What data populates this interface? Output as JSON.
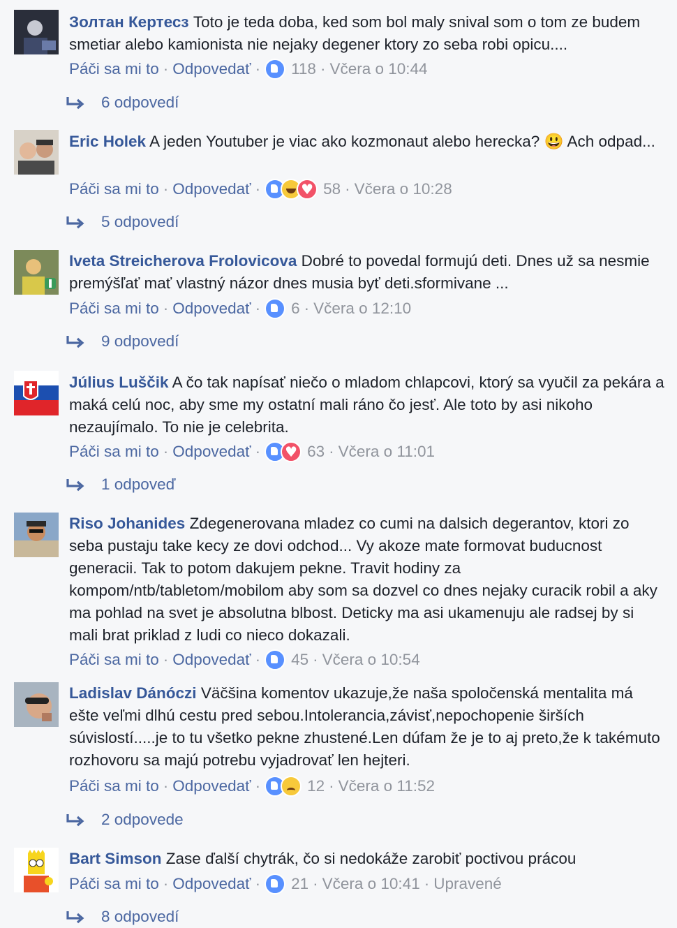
{
  "actions": {
    "like": "Páči sa mi to",
    "reply": "Odpovedať",
    "edited": "Upravené"
  },
  "colors": {
    "link": "#4b67a1",
    "author": "#365899",
    "meta": "#90949c",
    "like": "#5890ff",
    "love": "#f25268",
    "haha": "#f7c93b"
  },
  "comments": [
    {
      "author": "Золтан Кертесз",
      "text": "Toto je teda doba, ked som bol maly snival som o tom ze budem smetiar alebo kamionista nie nejaky degener ktory zo seba robi opicu....",
      "reactions": [
        "like-icon"
      ],
      "count": "118",
      "time": "Včera o 10:44",
      "replies": "6 odpovedí"
    },
    {
      "author": "Eric Holek",
      "text": "A jeden Youtuber je viac ako kozmonaut alebo herecka? 😃 Ach odpad...",
      "reactions": [
        "like-icon",
        "haha-icon",
        "love-icon"
      ],
      "count": "58",
      "time": "Včera o 10:28",
      "replies": "5 odpovedí"
    },
    {
      "author": "Iveta Streicherova Frolovicova",
      "text": "Dobré to povedal formujú deti. Dnes už sa nesmie premýšľať mať vlastný názor dnes musia byť deti.sformivane ...",
      "reactions": [
        "like-icon"
      ],
      "count": "6",
      "time": "Včera o 12:10",
      "replies": "9 odpovedí"
    },
    {
      "author": "Július Luščik",
      "text": "A čo tak napísať niečo o mladom chlapcovi, ktorý sa vyučil za pekára a maká celú noc, aby sme my ostatní mali ráno čo jesť. Ale toto by asi nikoho nezaujímalo. To nie je celebrita.",
      "reactions": [
        "like-icon",
        "love-icon"
      ],
      "count": "63",
      "time": "Včera o 11:01",
      "replies": "1 odpoveď"
    },
    {
      "author": "Riso Johanides",
      "text": "Zdegenerovana mladez co cumi na dalsich degerantov, ktori zo seba pustaju take kecy ze dovi odchod... Vy akoze mate formovat buducnost generacii. Tak to potom dakujem pekne. Travit hodiny za kompom/ntb/tabletom/mobilom aby som sa dozvel co dnes nejaky curacik robil a aky ma pohlad na svet je absolutna blbost. Deticky ma asi ukamenuju ale radsej by si mali brat priklad z ludi co nieco dokazali.",
      "reactions": [
        "like-icon"
      ],
      "count": "45",
      "time": "Včera o 10:54",
      "replies": ""
    },
    {
      "author": "Ladislav Dánóczi",
      "text": "Väčšina komentov ukazuje,že naša spoločenská mentalita má ešte veľmi dlhú cestu pred sebou.Intolerancia,závisť,nepochopenie širších súvislostí.....je to tu všetko pekne zhustené.Len dúfam že je to aj preto,že k takémuto rozhovoru sa majú potrebu vyjadrovať len hejteri.",
      "reactions": [
        "like-icon",
        "sad-icon"
      ],
      "count": "12",
      "time": "Včera o 11:52",
      "replies": "2 odpovede"
    },
    {
      "author": "Bart Simson",
      "text": "Zase ďalší chytrák, čo si nedokáže zarobiť poctivou prácou",
      "reactions": [
        "like-icon"
      ],
      "count": "21",
      "time": "Včera o 10:41",
      "edited": true,
      "replies": "8 odpovedí"
    }
  ]
}
